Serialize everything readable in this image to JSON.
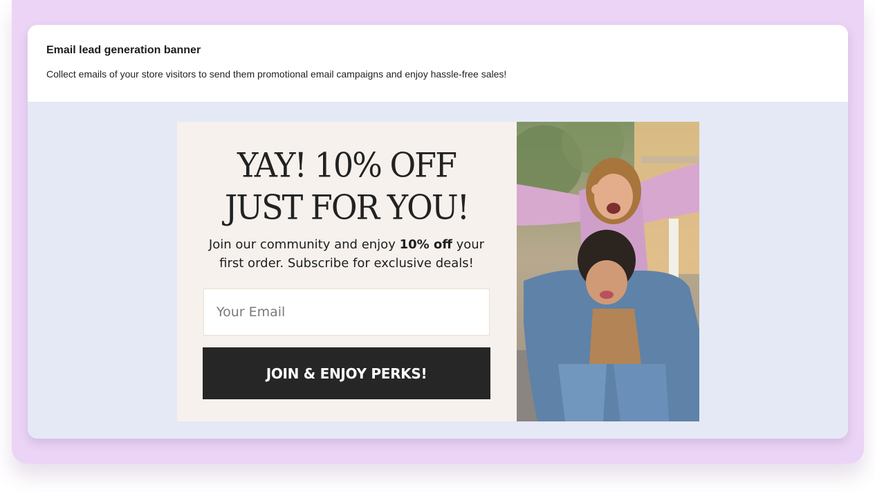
{
  "card": {
    "title": "Email lead generation banner",
    "description": "Collect emails of your store visitors to send them promotional email campaigns and enjoy hassle-free sales!"
  },
  "popup": {
    "headline_line1": "YAY! 10% OFF",
    "headline_line2": "JUST FOR YOU!",
    "subtext_before": "Join our community and enjoy ",
    "subtext_bold": "10% off",
    "subtext_after": " your first order. Subscribe for exclusive deals!",
    "email_placeholder": "Your Email",
    "email_value": "",
    "button_label": "JOIN & ENJOY PERKS!",
    "image_description": "couple-piggyback-photo"
  },
  "colors": {
    "outer_frame": "#ecd4f6",
    "card_body": "#e5e9f5",
    "popup_bg": "#f6f1ed",
    "button_bg": "#262626",
    "button_text": "#ffffff"
  }
}
